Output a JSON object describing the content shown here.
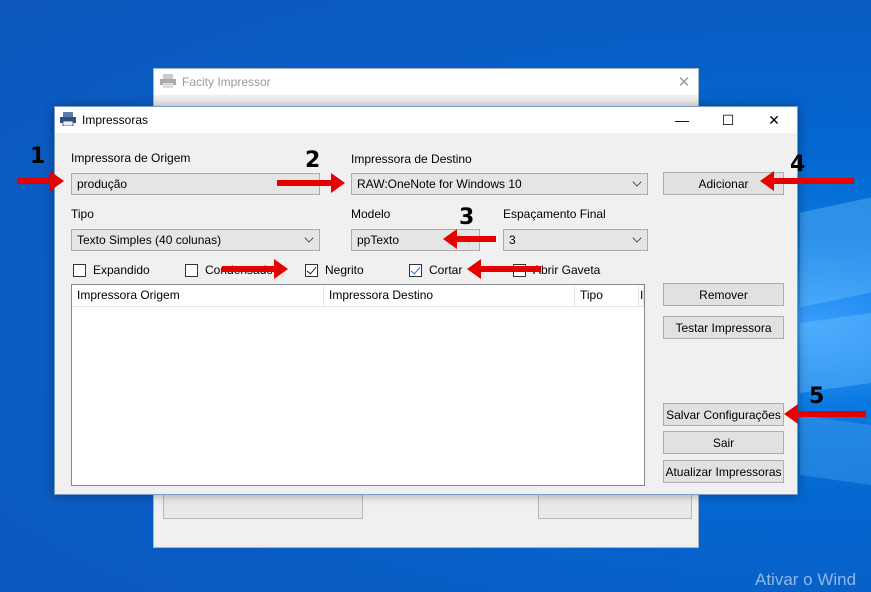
{
  "desktop": {
    "watermark": "Ativar o Wind"
  },
  "background_window": {
    "title": "Facity Impressor",
    "close": "✕"
  },
  "dialog": {
    "title": "Impressoras",
    "controls": {
      "minimize": "—",
      "maximize": "☐",
      "close": "✕"
    },
    "origem": {
      "label": "Impressora de Origem",
      "value": "produção"
    },
    "destino": {
      "label": "Impressora de Destino",
      "value": "RAW:OneNote for Windows 10"
    },
    "tipo": {
      "label": "Tipo",
      "value": "Texto Simples (40 colunas)"
    },
    "modelo": {
      "label": "Modelo",
      "value": "ppTexto"
    },
    "espacamento": {
      "label": "Espaçamento Final",
      "value": "3"
    },
    "checkboxes": [
      {
        "label": "Expandido",
        "checked": false
      },
      {
        "label": "Condensado",
        "checked": false
      },
      {
        "label": "Negrito",
        "checked": true
      },
      {
        "label": "Cortar",
        "checked": true
      },
      {
        "label": "Abrir Gaveta",
        "checked": false
      }
    ],
    "list": {
      "columns": [
        "Impressora Origem",
        "Impressora Destino",
        "Tipo",
        "I"
      ]
    },
    "buttons": {
      "adicionar": "Adicionar",
      "remover": "Remover",
      "testar": "Testar Impressora",
      "salvar": "Salvar Configurações",
      "sair": "Sair",
      "atualizar": "Atualizar Impressoras"
    }
  },
  "annotations": {
    "n1": "1",
    "n2": "2",
    "n3": "3",
    "n4": "4",
    "n5": "5"
  },
  "colors": {
    "desktop_blue": "#0467d0",
    "arrow_red": "#e60000",
    "check_blue": "#1f6fd1"
  }
}
